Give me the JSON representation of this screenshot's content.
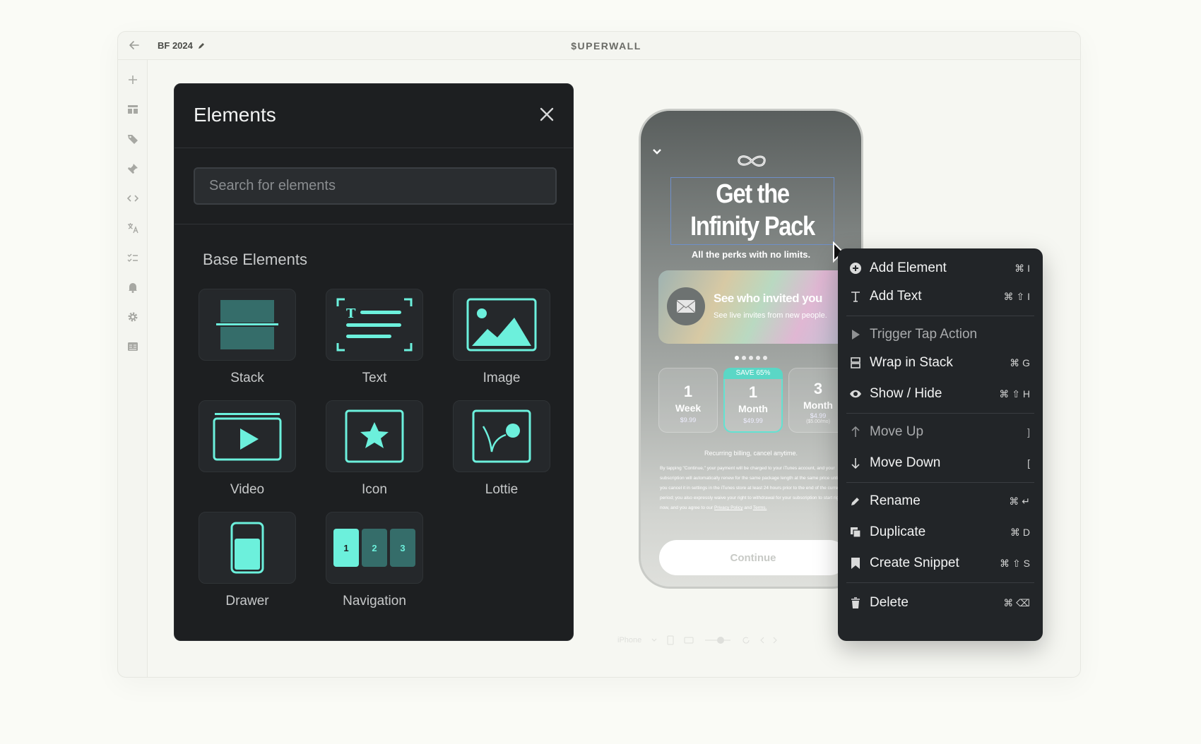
{
  "window": {
    "doc_title": "BF 2024",
    "brand": "$UPERWALL"
  },
  "sidebar": {
    "icons": [
      "plus-icon",
      "layout-icon",
      "tag-icon",
      "pin-icon",
      "code-icon",
      "translate-icon",
      "checklist-icon",
      "bell-icon",
      "gear-icon",
      "table-icon"
    ]
  },
  "elements_panel": {
    "title": "Elements",
    "search_placeholder": "Search for elements",
    "section_title": "Base Elements",
    "tiles": [
      {
        "label": "Stack"
      },
      {
        "label": "Text"
      },
      {
        "label": "Image"
      },
      {
        "label": "Video"
      },
      {
        "label": "Icon"
      },
      {
        "label": "Lottie"
      },
      {
        "label": "Drawer"
      },
      {
        "label": "Navigation"
      }
    ],
    "navigation_tile_numbers": [
      "1",
      "2",
      "3"
    ],
    "accent_color": "#6cf0dc"
  },
  "paywall_preview": {
    "headline_line1": "Get the",
    "headline_line2": "Infinity Pack",
    "subhead": "All the perks with no limits.",
    "promo_title": "See who invited you",
    "promo_subtitle": "See live invites from new people.",
    "plans": [
      {
        "number": "1",
        "unit": "Week",
        "price": "$9.99",
        "price_detail": ""
      },
      {
        "number": "1",
        "unit": "Month",
        "price": "$49.99",
        "price_detail": "",
        "badge": "SAVE 65%"
      },
      {
        "number": "3",
        "unit": "Month",
        "price": "$4.99",
        "price_detail": "($5.00/mo)"
      }
    ],
    "recurring": "Recurring billing, cancel anytime.",
    "legal": "By tapping \"Continue,\" your payment will be charged to your iTunes account, and your subscription will automatically renew for the same package length at the same price until you cancel it in settings in the iTunes store at least 24 hours prior to the end of the current period; you also expressly waive your right to withdrawal for your subscription to start right now, and you agree to our",
    "legal_privacy": "Privacy Policy",
    "legal_and": "and",
    "legal_terms": "Terms.",
    "continue_label": "Continue",
    "device_select": "iPhone"
  },
  "context_menu": {
    "items": [
      {
        "label": "Add Element",
        "shortcut": "⌘ I",
        "icon": "plus-circle-icon"
      },
      {
        "label": "Add Text",
        "shortcut": "⌘ ⇧ I",
        "icon": "text-icon"
      },
      {
        "label": "Trigger Tap Action",
        "shortcut": "",
        "icon": "play-icon"
      },
      {
        "label": "Wrap in Stack",
        "shortcut": "⌘ G",
        "icon": "stack-icon"
      },
      {
        "label": "Show / Hide",
        "shortcut": "⌘ ⇧ H",
        "icon": "eye-icon"
      },
      {
        "label": "Move Up",
        "shortcut": "]",
        "icon": "arrow-up-icon"
      },
      {
        "label": "Move Down",
        "shortcut": "[",
        "icon": "arrow-down-icon"
      },
      {
        "label": "Rename",
        "shortcut": "⌘ ↵",
        "icon": "pencil-icon"
      },
      {
        "label": "Duplicate",
        "shortcut": "⌘ D",
        "icon": "duplicate-icon"
      },
      {
        "label": "Create Snippet",
        "shortcut": "⌘ ⇧ S",
        "icon": "bookmark-icon"
      },
      {
        "label": "Delete",
        "shortcut": "⌘ ⌫",
        "icon": "trash-icon"
      }
    ]
  }
}
